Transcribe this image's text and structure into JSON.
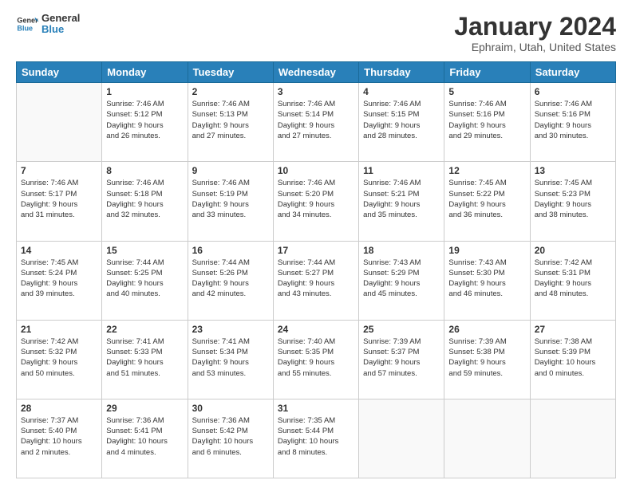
{
  "logo": {
    "text_general": "General",
    "text_blue": "Blue"
  },
  "header": {
    "title": "January 2024",
    "subtitle": "Ephraim, Utah, United States"
  },
  "weekdays": [
    "Sunday",
    "Monday",
    "Tuesday",
    "Wednesday",
    "Thursday",
    "Friday",
    "Saturday"
  ],
  "weeks": [
    [
      {
        "day": "",
        "empty": true
      },
      {
        "day": "1",
        "sunrise": "7:46 AM",
        "sunset": "5:12 PM",
        "daylight": "9 hours and 26 minutes."
      },
      {
        "day": "2",
        "sunrise": "7:46 AM",
        "sunset": "5:13 PM",
        "daylight": "9 hours and 27 minutes."
      },
      {
        "day": "3",
        "sunrise": "7:46 AM",
        "sunset": "5:14 PM",
        "daylight": "9 hours and 27 minutes."
      },
      {
        "day": "4",
        "sunrise": "7:46 AM",
        "sunset": "5:15 PM",
        "daylight": "9 hours and 28 minutes."
      },
      {
        "day": "5",
        "sunrise": "7:46 AM",
        "sunset": "5:16 PM",
        "daylight": "9 hours and 29 minutes."
      },
      {
        "day": "6",
        "sunrise": "7:46 AM",
        "sunset": "5:16 PM",
        "daylight": "9 hours and 30 minutes."
      }
    ],
    [
      {
        "day": "7",
        "sunrise": "7:46 AM",
        "sunset": "5:17 PM",
        "daylight": "9 hours and 31 minutes."
      },
      {
        "day": "8",
        "sunrise": "7:46 AM",
        "sunset": "5:18 PM",
        "daylight": "9 hours and 32 minutes."
      },
      {
        "day": "9",
        "sunrise": "7:46 AM",
        "sunset": "5:19 PM",
        "daylight": "9 hours and 33 minutes."
      },
      {
        "day": "10",
        "sunrise": "7:46 AM",
        "sunset": "5:20 PM",
        "daylight": "9 hours and 34 minutes."
      },
      {
        "day": "11",
        "sunrise": "7:46 AM",
        "sunset": "5:21 PM",
        "daylight": "9 hours and 35 minutes."
      },
      {
        "day": "12",
        "sunrise": "7:45 AM",
        "sunset": "5:22 PM",
        "daylight": "9 hours and 36 minutes."
      },
      {
        "day": "13",
        "sunrise": "7:45 AM",
        "sunset": "5:23 PM",
        "daylight": "9 hours and 38 minutes."
      }
    ],
    [
      {
        "day": "14",
        "sunrise": "7:45 AM",
        "sunset": "5:24 PM",
        "daylight": "9 hours and 39 minutes."
      },
      {
        "day": "15",
        "sunrise": "7:44 AM",
        "sunset": "5:25 PM",
        "daylight": "9 hours and 40 minutes."
      },
      {
        "day": "16",
        "sunrise": "7:44 AM",
        "sunset": "5:26 PM",
        "daylight": "9 hours and 42 minutes."
      },
      {
        "day": "17",
        "sunrise": "7:44 AM",
        "sunset": "5:27 PM",
        "daylight": "9 hours and 43 minutes."
      },
      {
        "day": "18",
        "sunrise": "7:43 AM",
        "sunset": "5:29 PM",
        "daylight": "9 hours and 45 minutes."
      },
      {
        "day": "19",
        "sunrise": "7:43 AM",
        "sunset": "5:30 PM",
        "daylight": "9 hours and 46 minutes."
      },
      {
        "day": "20",
        "sunrise": "7:42 AM",
        "sunset": "5:31 PM",
        "daylight": "9 hours and 48 minutes."
      }
    ],
    [
      {
        "day": "21",
        "sunrise": "7:42 AM",
        "sunset": "5:32 PM",
        "daylight": "9 hours and 50 minutes."
      },
      {
        "day": "22",
        "sunrise": "7:41 AM",
        "sunset": "5:33 PM",
        "daylight": "9 hours and 51 minutes."
      },
      {
        "day": "23",
        "sunrise": "7:41 AM",
        "sunset": "5:34 PM",
        "daylight": "9 hours and 53 minutes."
      },
      {
        "day": "24",
        "sunrise": "7:40 AM",
        "sunset": "5:35 PM",
        "daylight": "9 hours and 55 minutes."
      },
      {
        "day": "25",
        "sunrise": "7:39 AM",
        "sunset": "5:37 PM",
        "daylight": "9 hours and 57 minutes."
      },
      {
        "day": "26",
        "sunrise": "7:39 AM",
        "sunset": "5:38 PM",
        "daylight": "9 hours and 59 minutes."
      },
      {
        "day": "27",
        "sunrise": "7:38 AM",
        "sunset": "5:39 PM",
        "daylight": "10 hours and 0 minutes."
      }
    ],
    [
      {
        "day": "28",
        "sunrise": "7:37 AM",
        "sunset": "5:40 PM",
        "daylight": "10 hours and 2 minutes."
      },
      {
        "day": "29",
        "sunrise": "7:36 AM",
        "sunset": "5:41 PM",
        "daylight": "10 hours and 4 minutes."
      },
      {
        "day": "30",
        "sunrise": "7:36 AM",
        "sunset": "5:42 PM",
        "daylight": "10 hours and 6 minutes."
      },
      {
        "day": "31",
        "sunrise": "7:35 AM",
        "sunset": "5:44 PM",
        "daylight": "10 hours and 8 minutes."
      },
      {
        "day": "",
        "empty": true
      },
      {
        "day": "",
        "empty": true
      },
      {
        "day": "",
        "empty": true
      }
    ]
  ]
}
